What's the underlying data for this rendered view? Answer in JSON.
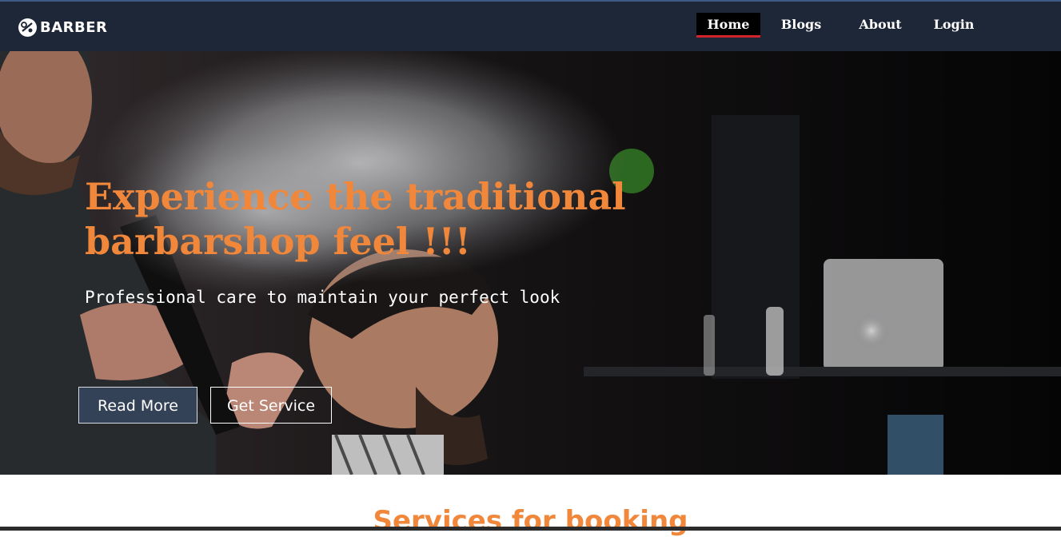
{
  "brand": {
    "name": "BARBER",
    "icon": "scissors-comb-logo-icon"
  },
  "nav": {
    "items": [
      {
        "label": "Home",
        "active": true
      },
      {
        "label": "Blogs",
        "active": false
      },
      {
        "label": "About",
        "active": false
      },
      {
        "label": "Login",
        "active": false
      }
    ]
  },
  "hero": {
    "title": "Experience the traditional barbarshop feel !!!",
    "subtitle": "Professional care to maintain your perfect look",
    "read_more_label": "Read More",
    "get_service_label": "Get Service",
    "image": "barber-spraying-client-hair-photo"
  },
  "services": {
    "heading": "Services for booking"
  },
  "colors": {
    "navbar": "#1e2737",
    "accent_orange": "#f0873a",
    "active_underline": "#d2232a",
    "read_more_bg": "#344257"
  }
}
